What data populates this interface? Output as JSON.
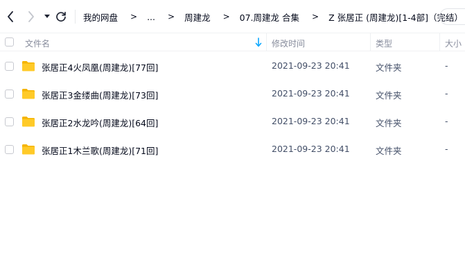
{
  "toolbar": {
    "back_icon": "chevron-left-icon",
    "forward_icon": "chevron-right-icon",
    "dropdown_icon": "caret-down-icon",
    "refresh_icon": "refresh-icon"
  },
  "breadcrumb": {
    "items": [
      "我的网盘",
      "...",
      "周建龙",
      "07.周建龙 合集",
      "Z 张居正 (周建龙)[1-4部]（完结）"
    ],
    "separator": ">"
  },
  "columns": {
    "name": "文件名",
    "modified": "修改时间",
    "type": "类型",
    "size": "大小",
    "sort_icon": "sort-down-arrow-icon"
  },
  "files": [
    {
      "name": "张居正4火凤凰(周建龙)[77回]",
      "modified": "2021-09-23 20:41",
      "type": "文件夹",
      "size": "-",
      "icon": "folder-icon"
    },
    {
      "name": "张居正3金缕曲(周建龙)[73回]",
      "modified": "2021-09-23 20:41",
      "type": "文件夹",
      "size": "-",
      "icon": "folder-icon"
    },
    {
      "name": "张居正2水龙吟(周建龙)[64回]",
      "modified": "2021-09-23 20:41",
      "type": "文件夹",
      "size": "-",
      "icon": "folder-icon"
    },
    {
      "name": "张居正1木兰歌(周建龙)[71回]",
      "modified": "2021-09-23 20:41",
      "type": "文件夹",
      "size": "-",
      "icon": "folder-icon"
    }
  ],
  "colors": {
    "folder": "#ffca28",
    "folder_tab": "#f5b400",
    "accent": "#06a7ff",
    "text_primary": "#03081a",
    "text_secondary": "#878c9c"
  }
}
